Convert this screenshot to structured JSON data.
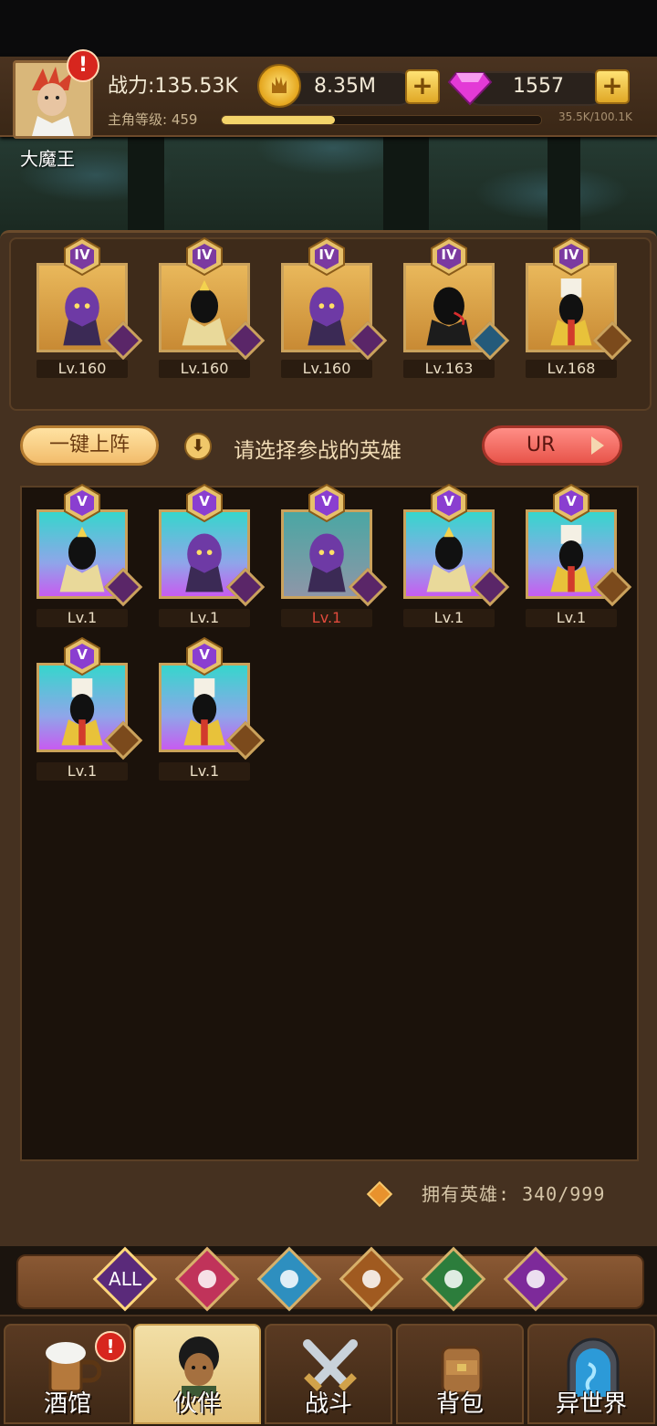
{
  "header": {
    "power": "战力:135.53K",
    "level_label": "主角等级: 459",
    "xp_text": "35.5K/100.1K",
    "xp_fraction": 0.355,
    "alert_mark": "!",
    "player_name": "大魔王"
  },
  "resources": {
    "gold": "8.35M",
    "gems": "1557",
    "plus": "+"
  },
  "lineup": [
    {
      "rank": "IV",
      "level": "Lv.160",
      "faction": "demon"
    },
    {
      "rank": "IV",
      "level": "Lv.160",
      "faction": "elf"
    },
    {
      "rank": "IV",
      "level": "Lv.160",
      "faction": "demon"
    },
    {
      "rank": "IV",
      "level": "Lv.163",
      "faction": "blue"
    },
    {
      "rank": "IV",
      "level": "Lv.168",
      "faction": "human"
    }
  ],
  "controls": {
    "one_key_deploy": "一键上阵",
    "hint": "请选择参战的英雄",
    "rarity_filter": "UR"
  },
  "roster": [
    {
      "rank": "V",
      "level": "Lv.1",
      "faction": "elf",
      "level_color": "normal"
    },
    {
      "rank": "V",
      "level": "Lv.1",
      "faction": "demon",
      "level_color": "normal"
    },
    {
      "rank": "V",
      "level": "Lv.1",
      "faction": "demon",
      "level_color": "red"
    },
    {
      "rank": "V",
      "level": "Lv.1",
      "faction": "elf",
      "level_color": "normal"
    },
    {
      "rank": "V",
      "level": "Lv.1",
      "faction": "human",
      "level_color": "normal"
    },
    {
      "rank": "V",
      "level": "Lv.1",
      "faction": "human",
      "level_color": "normal"
    },
    {
      "rank": "V",
      "level": "Lv.1",
      "faction": "human",
      "level_color": "normal"
    }
  ],
  "owned": "拥有英雄: 340/999",
  "filters": [
    "ALL",
    "human-icon",
    "blue-icon",
    "lion-icon",
    "elf-icon",
    "demon-icon"
  ],
  "filter_all_label": "ALL",
  "nav": {
    "tavern": "酒馆",
    "partner": "伙伴",
    "battle": "战斗",
    "bag": "背包",
    "otherworld": "异世界",
    "alert_mark": "!"
  },
  "colors": {
    "accent_gold": "#caa25c",
    "ur_red": "#e8544a",
    "panel_brown": "#453120"
  }
}
